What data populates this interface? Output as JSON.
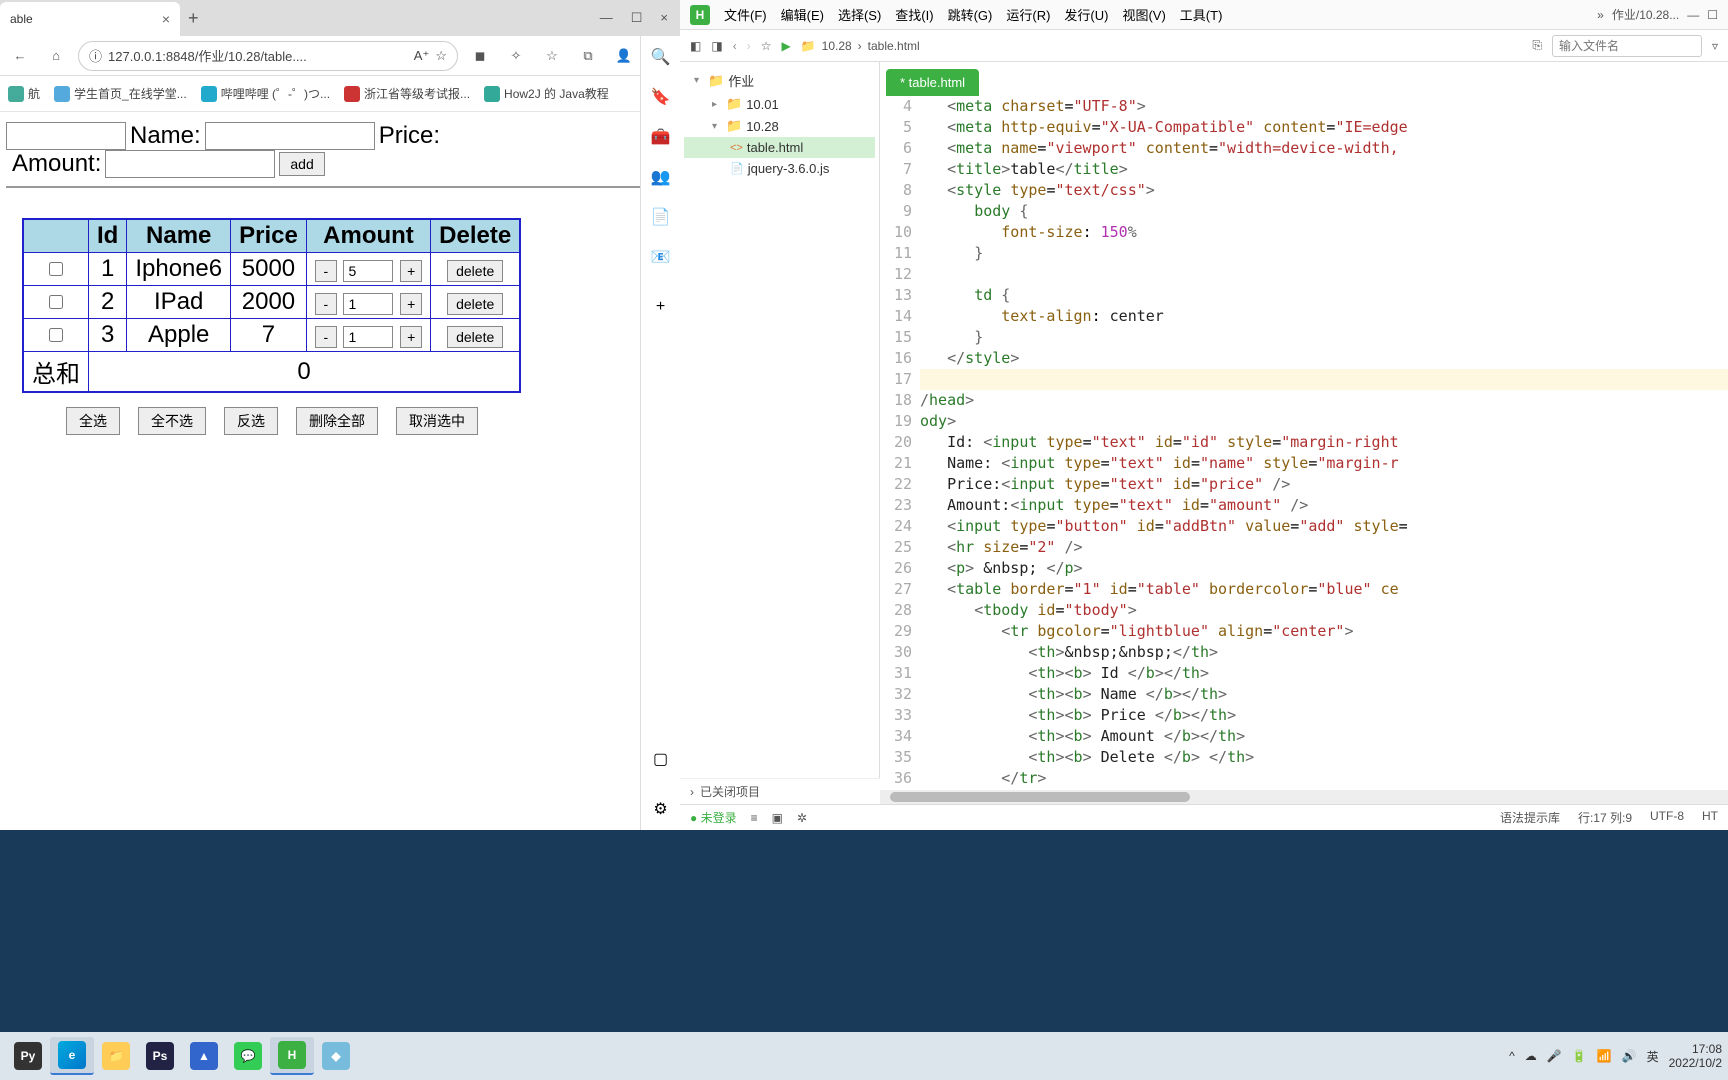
{
  "edge": {
    "tab_title": "able",
    "url": "127.0.0.1:8848/作业/10.28/table....",
    "bookmarks": [
      {
        "label": "航",
        "color": "#4a9"
      },
      {
        "label": "学生首页_在线学堂...",
        "color": "#5ad"
      },
      {
        "label": "哔哩哔哩 (゜-゜)つ...",
        "color": "#f8b"
      },
      {
        "label": "浙江省等级考试报...",
        "color": "#c33"
      },
      {
        "label": "How2J 的 Java教程",
        "color": "#3a9"
      }
    ]
  },
  "page": {
    "labels": {
      "id": "",
      "name": "Name:",
      "price": "Price:",
      "amount": "Amount:",
      "add": "add"
    },
    "headers": [
      "",
      "Id",
      "Name",
      "Price",
      "Amount",
      "Delete"
    ],
    "rows": [
      {
        "id": "1",
        "name": "Iphone6",
        "price": "5000",
        "amount": "5"
      },
      {
        "id": "2",
        "name": "IPad",
        "price": "2000",
        "amount": "1"
      },
      {
        "id": "3",
        "name": "Apple",
        "price": "7",
        "amount": "1"
      }
    ],
    "delete_label": "delete",
    "sum_label": "总和",
    "sum_value": "0",
    "btns": [
      "全选",
      "全不选",
      "反选",
      "删除全部",
      "取消选中"
    ]
  },
  "hb": {
    "menus": [
      "文件(F)",
      "编辑(E)",
      "选择(S)",
      "查找(I)",
      "跳转(G)",
      "运行(R)",
      "发行(U)",
      "视图(V)",
      "工具(T)"
    ],
    "wintitle": "作业/10.28...",
    "crumb": [
      "10.28",
      "table.html"
    ],
    "finder_ph": "输入文件名",
    "tree": {
      "root": "作业",
      "f1": "10.01",
      "f2": "10.28",
      "file1": "table.html",
      "file2": "jquery-3.6.0.js"
    },
    "closed_proj": "已关闭项目",
    "filetab": "* table.html",
    "status": {
      "login": "未登录",
      "hint": "语法提示库",
      "pos": "行:17  列:9",
      "enc": "UTF-8",
      "lang": "HT"
    },
    "code_start": 4
  },
  "taskbar": {
    "ime": "英",
    "time": "17:08",
    "date": "2022/10/2"
  },
  "chart_data": {
    "type": "table",
    "columns": [
      "Id",
      "Name",
      "Price",
      "Amount"
    ],
    "rows": [
      [
        1,
        "Iphone6",
        5000,
        5
      ],
      [
        2,
        "IPad",
        2000,
        1
      ],
      [
        3,
        "Apple",
        7,
        1
      ]
    ],
    "sum": 0
  }
}
